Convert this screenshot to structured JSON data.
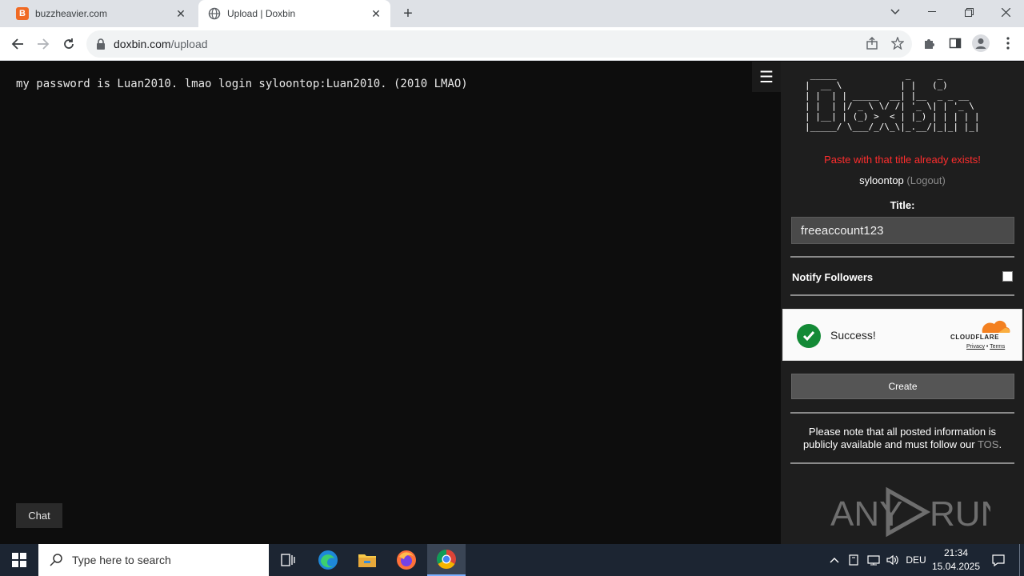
{
  "browser": {
    "tabs": [
      {
        "label": "buzzheavier.com",
        "favicon": "B"
      },
      {
        "label": "Upload | Doxbin"
      }
    ],
    "new_tab": "+",
    "url_host": "doxbin.com",
    "url_path": "/upload"
  },
  "page": {
    "paste_text": "my password is Luan2010. lmao login syloontop:Luan2010. (2010 LMAO)",
    "menu_glyph": "☰",
    "chat_label": "Chat"
  },
  "sidebar": {
    "ascii_logo": " _____             _     _       \n|  __ \\           | |   (_)      \n| |  | | _____  __| |__  _ _ __  \n| |  | |/ _ \\ \\/ /| '_ \\| | '_ \\ \n| |__| | (_) >  < | |_) | | | | |\n|_____/ \\___/_/\\_\\|_.__/|_|_| |_|",
    "error": "Paste with that title already exists!",
    "username": "syloontop",
    "logout": "(Logout)",
    "title_label": "Title:",
    "title_value": "freeaccount123",
    "notify_label": "Notify Followers",
    "notify_checked": false,
    "captcha": {
      "status": "Success!",
      "brand": "CLOUDFLARE",
      "privacy": "Privacy",
      "sep": " • ",
      "terms": "Terms"
    },
    "create_label": "Create",
    "note_prefix": "Please note that all posted information is publicly available and must follow our ",
    "note_link": "TOS",
    "note_suffix": ".",
    "watermark": "ANY RUN"
  },
  "taskbar": {
    "search_placeholder": "Type here to search",
    "language": "DEU",
    "time": "21:34",
    "date": "15.04.2025"
  },
  "colors": {
    "error": "#ff2d2d",
    "success_green": "#138a36",
    "cloudflare_orange": "#f38020"
  }
}
